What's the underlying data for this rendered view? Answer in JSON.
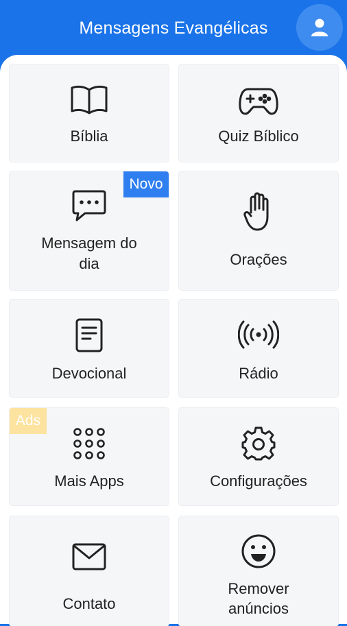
{
  "header": {
    "title": "Mensagens Evangélicas",
    "profile_icon": "user-profile-icon"
  },
  "menu": {
    "biblia": {
      "label": "Bíblia",
      "icon": "book-icon"
    },
    "quiz": {
      "label": "Quiz Bíblico",
      "icon": "gamepad-icon"
    },
    "mensagem": {
      "label_line1": "Mensagem do",
      "label_line2": "dia",
      "icon": "chat-bubble-icon",
      "badge": "Novo"
    },
    "oracoes": {
      "label": "Orações",
      "icon": "hand-icon"
    },
    "devocional": {
      "label": "Devocional",
      "icon": "document-icon"
    },
    "radio": {
      "label": "Rádio",
      "icon": "radio-broadcast-icon"
    },
    "mais_apps": {
      "label": "Mais Apps",
      "icon": "grid-dots-icon",
      "badge": "Ads"
    },
    "configuracoes": {
      "label": "Configurações",
      "icon": "gear-icon"
    },
    "contato": {
      "label": "Contato",
      "icon": "envelope-icon"
    },
    "remover": {
      "label_line1": "Remover",
      "label_line2": "anúncios",
      "icon": "smiley-icon"
    }
  },
  "colors": {
    "primary": "#1a73e8",
    "card_bg": "#f5f6f8",
    "badge_new": "#2f7ff0",
    "badge_ads": "#fde3a0"
  }
}
